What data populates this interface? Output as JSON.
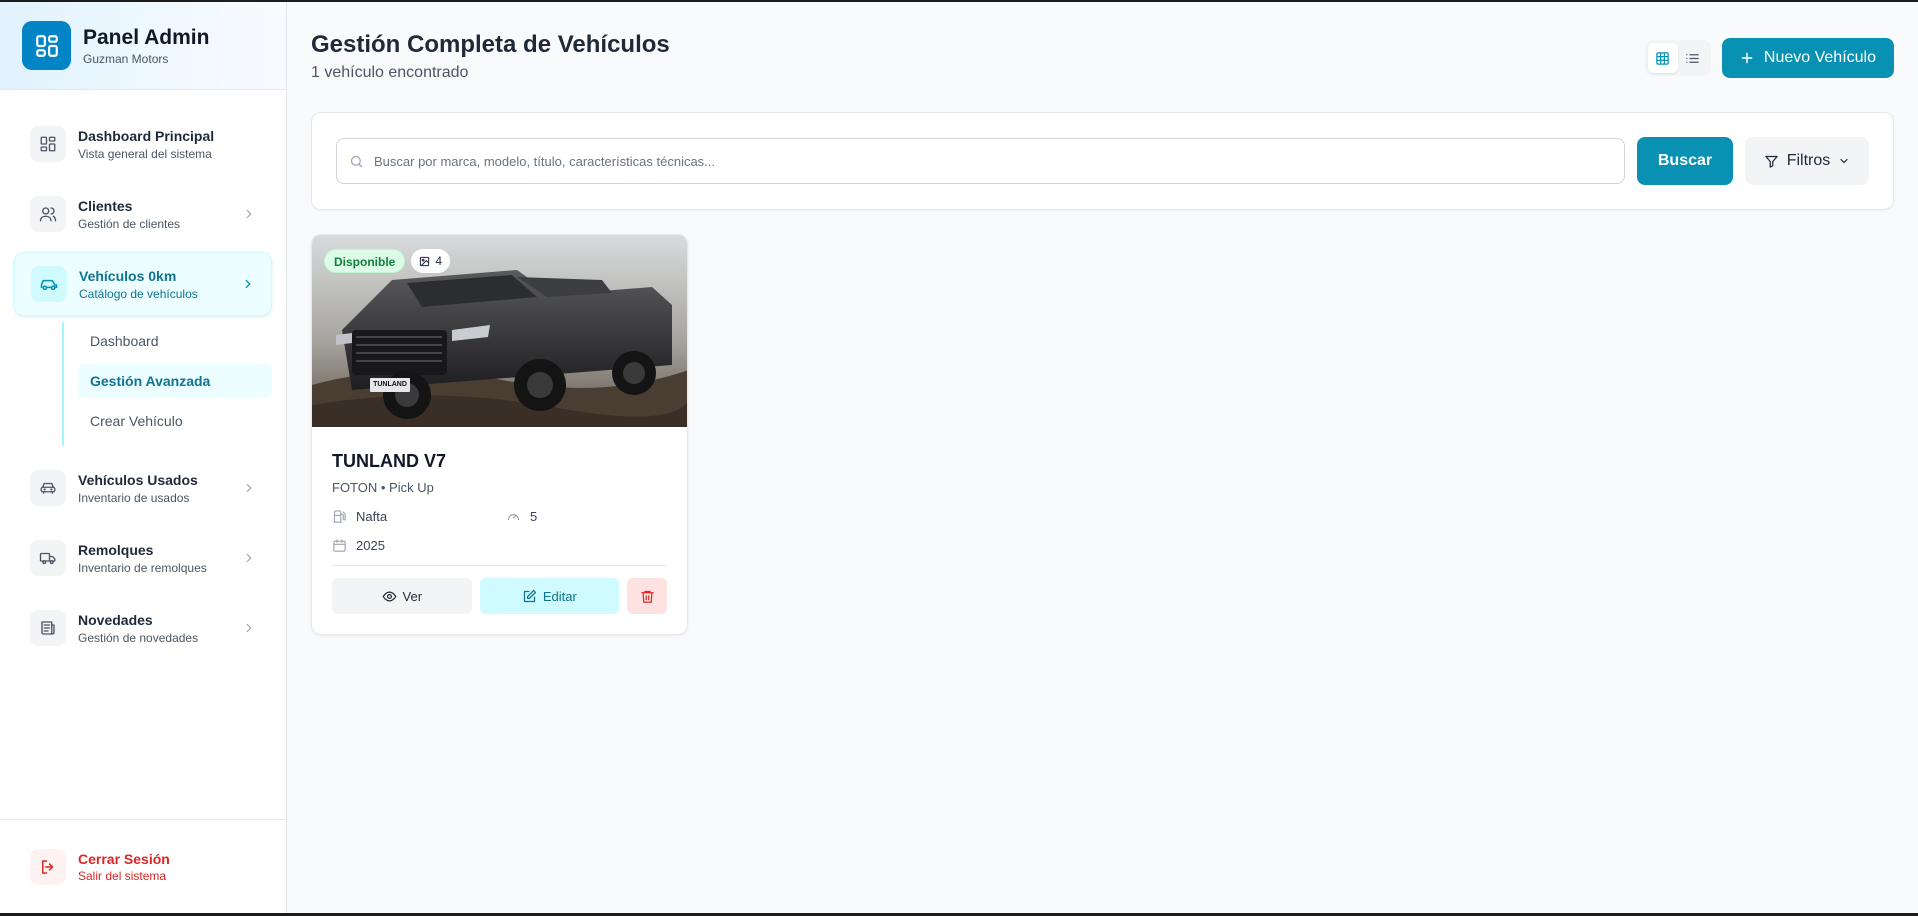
{
  "brand": {
    "title": "Panel Admin",
    "subtitle": "Guzman Motors"
  },
  "nav": {
    "items": [
      {
        "title": "Dashboard Principal",
        "subtitle": "Vista general del sistema"
      },
      {
        "title": "Clientes",
        "subtitle": "Gestión de clientes"
      },
      {
        "title": "Vehículos 0km",
        "subtitle": "Catálogo de vehículos"
      },
      {
        "title": "Vehículos Usados",
        "subtitle": "Inventario de usados"
      },
      {
        "title": "Remolques",
        "subtitle": "Inventario de remolques"
      },
      {
        "title": "Novedades",
        "subtitle": "Gestión de novedades"
      }
    ],
    "subitems": [
      "Dashboard",
      "Gestión Avanzada",
      "Crear Vehículo"
    ]
  },
  "logout": {
    "title": "Cerrar Sesión",
    "subtitle": "Salir del sistema"
  },
  "header": {
    "title": "Gestión Completa de Vehículos",
    "subtitle": "1 vehículo encontrado",
    "new_button": "Nuevo Vehículo"
  },
  "search": {
    "placeholder": "Buscar por marca, modelo, título, características técnicas...",
    "value": "",
    "search_button": "Buscar",
    "filters_button": "Filtros"
  },
  "vehicles": [
    {
      "status": "Disponible",
      "photo_count": "4",
      "title": "TUNLAND V7",
      "subtitle": "FOTON • Pick Up",
      "fuel": "Nafta",
      "seats": "5",
      "year": "2025",
      "plate_text": "TUNLAND",
      "actions": {
        "view": "Ver",
        "edit": "Editar"
      }
    }
  ],
  "colors": {
    "accent": "#0891b2",
    "accent_dark": "#0e7490",
    "status_green": "#15803d",
    "danger": "#dc2626"
  }
}
